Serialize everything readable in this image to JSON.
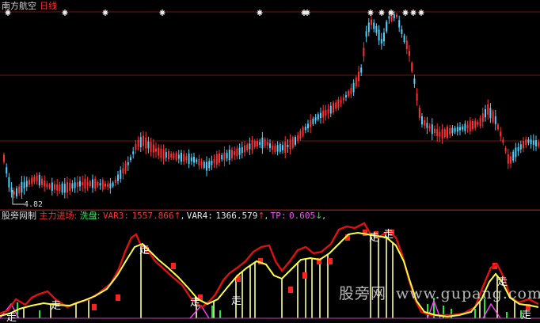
{
  "header": {
    "stock_name": "南方航空",
    "period": "日线"
  },
  "low_marker": "4.82",
  "indicator": {
    "name": "股旁网制",
    "line1": "主力进场:",
    "line2": "洗盘:",
    "var3_label": "VAR3:",
    "var3_value": "1557.866",
    "var4_label": "VAR4:",
    "var4_value": "1366.579",
    "tp_label": "TP:",
    "tp_value": "0.605",
    "up_arrow": "↑",
    "down_arrow": "↓"
  },
  "sell_marker_glyph": "走",
  "watermark": {
    "site": "股旁网",
    "url": "www.gupang.com"
  },
  "colors": {
    "up": "#ff3030",
    "down": "#50d0ff",
    "grid": "#7a1010",
    "ma": "#ffff40",
    "ind_red": "#e01010",
    "bar_yellow": "#ffffa0",
    "magenta": "#ff40ff",
    "green": "#30e040"
  }
}
